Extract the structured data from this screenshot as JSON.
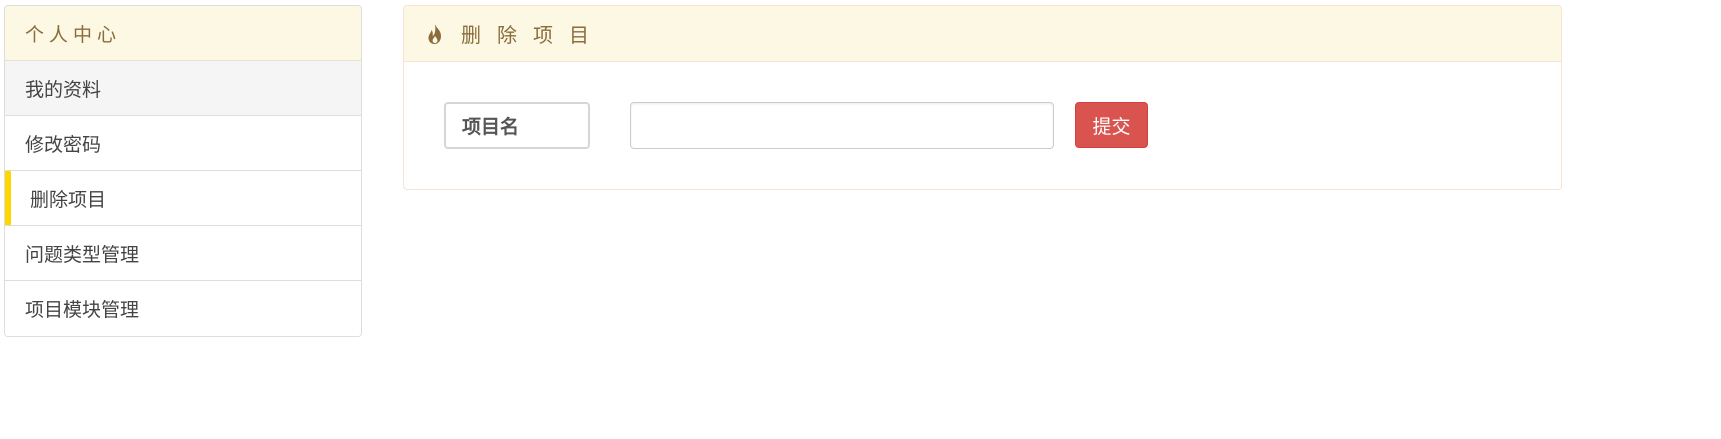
{
  "sidebar": {
    "title": "个人中心",
    "items": [
      {
        "label": "我的资料",
        "state": "hover"
      },
      {
        "label": "修改密码",
        "state": "normal"
      },
      {
        "label": "删除项目",
        "state": "active"
      },
      {
        "label": "问题类型管理",
        "state": "normal"
      },
      {
        "label": "项目模块管理",
        "state": "normal"
      }
    ],
    "active_accent_color": "#ffd700"
  },
  "main": {
    "icon": "fire-icon",
    "title": "删除项目",
    "form": {
      "field_label": "项目名",
      "input_value": "",
      "input_placeholder": "",
      "submit_label": "提交",
      "submit_color": "#d9534f"
    }
  },
  "colors": {
    "heading_bg": "#fcf8e3",
    "heading_text": "#8a6d3b"
  }
}
